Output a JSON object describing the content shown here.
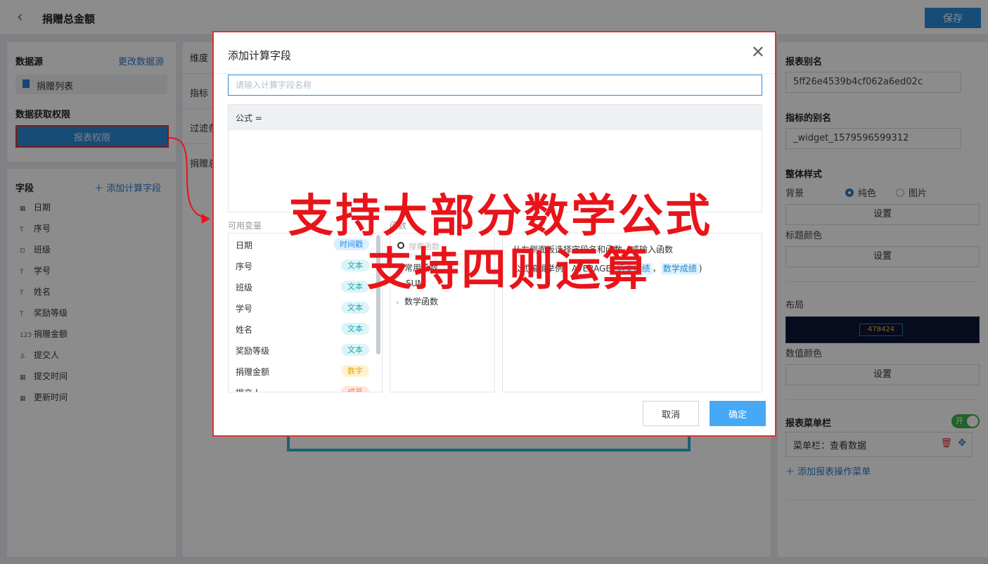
{
  "header": {
    "title": "捐赠总金额",
    "save_label": "保存"
  },
  "left": {
    "datasource_title": "数据源",
    "change_datasource": "更改数据源",
    "datasource_item": "捐赠列表",
    "permission_title": "数据获取权限",
    "permission_button": "报表权限",
    "fields_title": "字段",
    "add_calc_field": "添加计算字段",
    "fields": [
      {
        "icon": "▦",
        "label": "日期"
      },
      {
        "icon": "T",
        "label": "序号"
      },
      {
        "icon": "⊡",
        "label": "班级"
      },
      {
        "icon": "T",
        "label": "学号"
      },
      {
        "icon": "T",
        "label": "姓名"
      },
      {
        "icon": "T",
        "label": "奖励等级"
      },
      {
        "icon": "123",
        "label": "捐赠金额"
      },
      {
        "icon": "♙",
        "label": "提交人"
      },
      {
        "icon": "▦",
        "label": "提交时间"
      },
      {
        "icon": "▦",
        "label": "更新时间"
      }
    ]
  },
  "middle": {
    "labels": [
      "维度",
      "指标",
      "过滤条",
      "捐赠总"
    ]
  },
  "right": {
    "report_alias_title": "报表别名",
    "report_alias_value": "5ff26e4539b4cf062a6ed02c",
    "metric_alias_title": "指标的别名",
    "metric_alias_value": "_widget_1579596599312",
    "style_title": "整体样式",
    "bg_label": "背景",
    "radio_solid": "纯色",
    "radio_image": "图片",
    "set_label": "设置",
    "title_color_label": "标题颜色",
    "layout_label": "布局",
    "layout_preview_value": "478424",
    "value_color_label": "数值颜色",
    "menu_bar_title": "报表菜单栏",
    "toggle_label": "开",
    "menu_item": "菜单栏：查看数据",
    "add_menu": "添加报表操作菜单"
  },
  "dialog": {
    "title": "添加计算字段",
    "name_placeholder": "请输入计算字段名称",
    "formula_label": "公式 =",
    "vars_label": "可用变量",
    "functions_label": "函数",
    "variables": [
      {
        "name": "日期",
        "type": "时间戳",
        "kind": "time"
      },
      {
        "name": "序号",
        "type": "文本",
        "kind": "text"
      },
      {
        "name": "班级",
        "type": "文本",
        "kind": "text"
      },
      {
        "name": "学号",
        "type": "文本",
        "kind": "text"
      },
      {
        "name": "姓名",
        "type": "文本",
        "kind": "text"
      },
      {
        "name": "奖励等级",
        "type": "文本",
        "kind": "text"
      },
      {
        "name": "捐赠金额",
        "type": "数字",
        "kind": "num"
      },
      {
        "name": "提交人",
        "type": "成员",
        "kind": "member"
      }
    ],
    "fn_search_placeholder": "搜索函数",
    "fn_groups": [
      "常用函数",
      "SUM",
      "数学函数"
    ],
    "help_line1": "从左侧面板选择字段名和函数，或输入函数",
    "help_line2_prefix": "公式编辑举例：AVERAGE(",
    "help_chip1": "语文成绩",
    "help_sep": "，",
    "help_chip2": "数学成绩",
    "help_line2_suffix": ")",
    "cancel": "取消",
    "ok": "确定"
  },
  "annotations": {
    "caption1": "支持大部分数学公式",
    "caption2": "支持四则运算"
  },
  "colors": {
    "accent": "#2b8ad9",
    "annotation_red": "#e8141a"
  }
}
